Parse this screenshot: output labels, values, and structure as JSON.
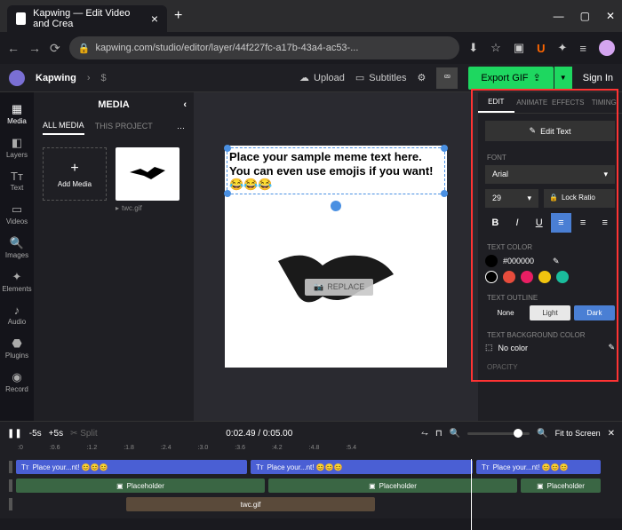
{
  "browser": {
    "tab_title": "Kapwing — Edit Video and Crea",
    "url": "kapwing.com/studio/editor/layer/44f227fc-a17b-43a4-ac53-..."
  },
  "app": {
    "name": "Kapwing",
    "upload": "Upload",
    "subtitles": "Subtitles",
    "export": "Export GIF",
    "signin": "Sign In"
  },
  "rail": {
    "media": "Media",
    "layers": "Layers",
    "text": "Text",
    "videos": "Videos",
    "images": "Images",
    "elements": "Elements",
    "audio": "Audio",
    "plugins": "Plugins",
    "record": "Record"
  },
  "media_panel": {
    "title": "MEDIA",
    "tab_all": "ALL MEDIA",
    "tab_project": "THIS PROJECT",
    "add": "Add Media",
    "thumb_name": "twc.gif"
  },
  "canvas": {
    "meme_text": "Place your sample meme text here. You can even use emojis if you want! 😂😂😂",
    "replace": "REPLACE"
  },
  "right": {
    "tab_edit": "EDIT",
    "tab_animate": "ANIMATE",
    "tab_effects": "EFFECTS",
    "tab_timing": "TIMING",
    "edit_text": "Edit Text",
    "font_label": "FONT",
    "font_value": "Arial",
    "size_value": "29",
    "lock_ratio": "Lock Ratio",
    "text_color_label": "TEXT COLOR",
    "hex": "#000000",
    "outline_label": "TEXT OUTLINE",
    "outline_none": "None",
    "outline_light": "Light",
    "outline_dark": "Dark",
    "bg_label": "TEXT BACKGROUND COLOR",
    "no_color": "No color",
    "opacity_label": "OPACITY"
  },
  "timeline": {
    "minus5": "-5s",
    "plus5": "+5s",
    "split": "Split",
    "time": "0:02.49 / 0:05.00",
    "fit": "Fit to Screen",
    "ruler": [
      ":0",
      ":0.6",
      ":1.2",
      ":1.8",
      ":2.4",
      ":3.0",
      ":3.6",
      ":4.2",
      ":4.8",
      ":5.4"
    ],
    "clip_text_short": "Place your...nt! 😊😊😊",
    "clip_text_long": "Place your...nt! 😊😊😊",
    "clip_placeholder": "Placeholder",
    "clip_media": "twc.gif"
  }
}
